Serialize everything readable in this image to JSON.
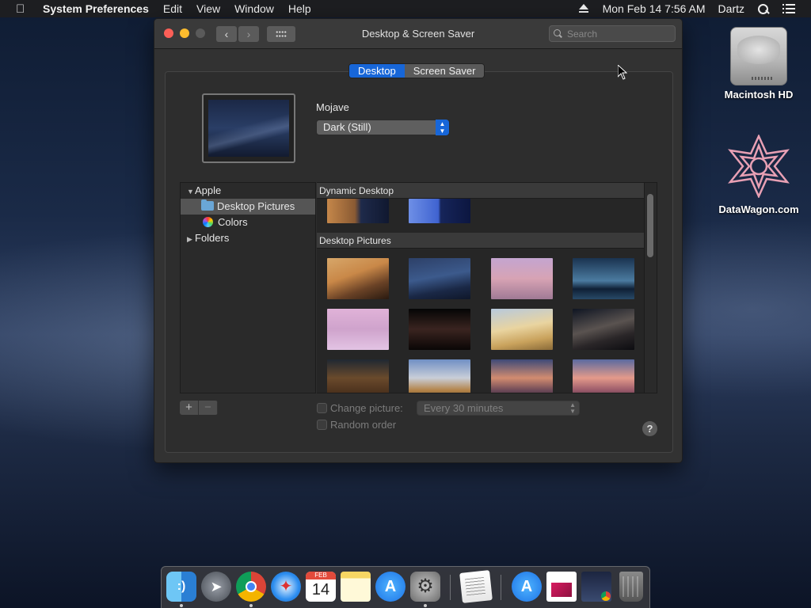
{
  "menubar": {
    "app_name": "System Preferences",
    "menus": [
      "Edit",
      "View",
      "Window",
      "Help"
    ],
    "clock": "Mon Feb 14  7:56 AM",
    "user": "Dartz"
  },
  "window": {
    "title": "Desktop & Screen Saver",
    "search_placeholder": "Search",
    "tabs": [
      {
        "label": "Desktop",
        "selected": true
      },
      {
        "label": "Screen Saver",
        "selected": false
      }
    ],
    "current_wallpaper_name": "Mojave",
    "appearance_popup_value": "Dark (Still)",
    "source_list": [
      {
        "label": "Apple",
        "expanded": true,
        "level": 0
      },
      {
        "label": "Desktop Pictures",
        "selected": true,
        "level": 1
      },
      {
        "label": "Colors",
        "level": 1
      },
      {
        "label": "Folders",
        "expanded": false,
        "level": 0
      }
    ],
    "sections": {
      "dynamic_desktop": "Dynamic Desktop",
      "desktop_pictures": "Desktop Pictures"
    },
    "change_picture_label": "Change picture:",
    "change_picture_interval": "Every 30 minutes",
    "random_order_label": "Random order",
    "add_label": "+",
    "remove_label": "−",
    "help_label": "?"
  },
  "desktop_icons": [
    {
      "label": "Macintosh HD",
      "icon": "hard-drive-icon"
    },
    {
      "label": "DataWagon.com",
      "icon": "datawagon-star-icon"
    }
  ],
  "dock": {
    "calendar_month": "FEB",
    "calendar_day": "14",
    "items": [
      "finder-icon",
      "launchpad-icon",
      "chrome-icon",
      "safari-icon",
      "calendar-icon",
      "notes-icon",
      "app-store-icon",
      "system-preferences-icon",
      "textedit-icon",
      "app-store-downloads-icon",
      "preview-document-icon",
      "screenshot-icon",
      "trash-icon"
    ]
  },
  "colors": {
    "accent": "#1766d8",
    "close": "#fc5f57",
    "minimize": "#fdbc2e"
  }
}
